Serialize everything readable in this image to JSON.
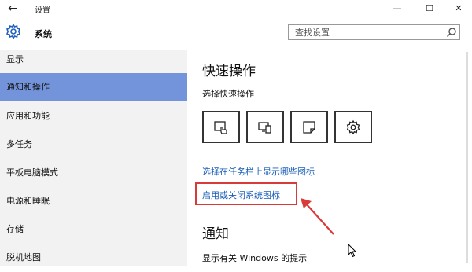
{
  "window": {
    "title": "设置",
    "back_glyph": "←",
    "minimize_glyph": "—",
    "maximize_glyph": "☐",
    "close_glyph": "✕"
  },
  "header": {
    "title": "系统",
    "icon": "gear-icon"
  },
  "search": {
    "placeholder": "查找设置",
    "icon": "search-icon"
  },
  "sidebar": {
    "items": [
      {
        "label": "显示",
        "active": false
      },
      {
        "label": "通知和操作",
        "active": true
      },
      {
        "label": "应用和功能",
        "active": false
      },
      {
        "label": "多任务",
        "active": false
      },
      {
        "label": "平板电脑模式",
        "active": false
      },
      {
        "label": "电源和睡眠",
        "active": false
      },
      {
        "label": "存储",
        "active": false
      },
      {
        "label": "脱机地图",
        "active": false
      }
    ]
  },
  "main": {
    "quick_actions": {
      "title": "快速操作",
      "subtitle": "选择快速操作",
      "tiles": [
        {
          "icon": "tablet-mode-icon"
        },
        {
          "icon": "project-icon"
        },
        {
          "icon": "note-icon"
        },
        {
          "icon": "settings-gear-icon"
        }
      ]
    },
    "links": {
      "taskbar_icons": "选择在任务栏上显示哪些图标",
      "system_icons": "启用或关闭系统图标"
    },
    "notifications": {
      "title": "通知",
      "tips_label": "显示有关 Windows 的提示"
    }
  },
  "colors": {
    "accent": "#7393da",
    "link": "#1a5fb8",
    "highlight": "#d93a3a"
  }
}
